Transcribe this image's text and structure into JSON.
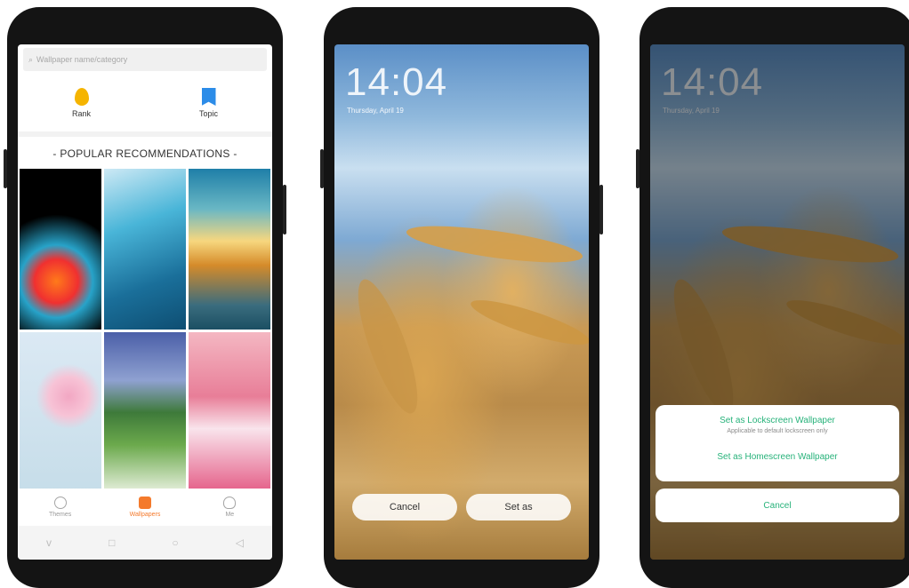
{
  "phone1": {
    "search_placeholder": "Wallpaper name/category",
    "shortcuts": [
      {
        "label": "Rank",
        "icon": "flame-icon"
      },
      {
        "label": "Topic",
        "icon": "bookmark-icon"
      }
    ],
    "section_title": "POPULAR RECOMMENDATIONS",
    "tabs": [
      {
        "label": "Themes",
        "icon": "themes-icon",
        "active": false
      },
      {
        "label": "Wallpapers",
        "icon": "wallpaper-icon",
        "active": true
      },
      {
        "label": "Me",
        "icon": "person-icon",
        "active": false
      }
    ],
    "nav": [
      "v",
      "□",
      "○",
      "◁"
    ]
  },
  "phone2": {
    "time": "14:04",
    "date": "Thursday, April 19",
    "cancel": "Cancel",
    "set_as": "Set as"
  },
  "phone3": {
    "time": "14:04",
    "date": "Thursday, April 19",
    "set_lock": "Set as Lockscreen Wallpaper",
    "set_lock_sub": "Applicable to default lockscreen only",
    "set_home": "Set as Homescreen Wallpaper",
    "cancel": "Cancel"
  },
  "colors": {
    "accent_orange": "#f47a2c",
    "accent_green": "#27b27a"
  }
}
